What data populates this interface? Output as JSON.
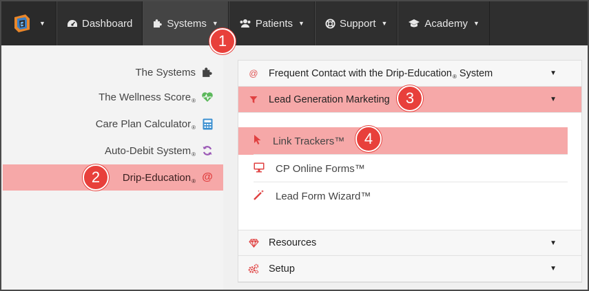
{
  "topnav": {
    "brand_icon": "brand-logo-icon",
    "items": [
      {
        "label": "Dashboard",
        "icon": "dashboard-gauge-icon"
      },
      {
        "label": "Systems",
        "icon": "puzzle-icon"
      },
      {
        "label": "Patients",
        "icon": "users-icon"
      },
      {
        "label": "Support",
        "icon": "lifebuoy-icon"
      },
      {
        "label": "Academy",
        "icon": "graduation-cap-icon"
      }
    ]
  },
  "sidebar": {
    "items": [
      {
        "label": "The Systems",
        "icon": "puzzle-icon"
      },
      {
        "label": "The Wellness Score",
        "reg": "®",
        "icon": "heartbeat-icon"
      },
      {
        "label": "Care Plan Calculator",
        "reg": "®",
        "icon": "calculator-icon"
      },
      {
        "label": "Auto-Debit System",
        "reg": "®",
        "icon": "refresh-icon"
      },
      {
        "label": "Drip-Education",
        "reg": "®",
        "icon": "at-icon"
      }
    ]
  },
  "panel": {
    "sections": [
      {
        "label": "Frequent Contact with the Drip-Education",
        "reg": "®",
        "label_suffix": " System",
        "icon": "at-icon"
      },
      {
        "label": "Lead Generation Marketing",
        "icon": "filter-icon"
      },
      {
        "label": "Resources",
        "icon": "diamond-icon"
      },
      {
        "label": "Setup",
        "icon": "cogs-icon"
      }
    ],
    "sub_items": [
      {
        "label": "Link Trackers™",
        "icon": "mouse-pointer-icon"
      },
      {
        "label": "CP Online Forms™",
        "icon": "monitor-icon"
      },
      {
        "label": "Lead Form Wizard™",
        "icon": "magic-wand-icon"
      }
    ]
  },
  "badges": [
    "1",
    "2",
    "3",
    "4"
  ],
  "colors": {
    "nav_bg": "#2f2f2f",
    "highlight": "#f6a8a8",
    "accent_red": "#e05050",
    "badge_red": "#e8403b",
    "heart_green": "#5cb85c",
    "calc_blue": "#3a8fd0",
    "refresh_purple": "#9b59b6"
  }
}
